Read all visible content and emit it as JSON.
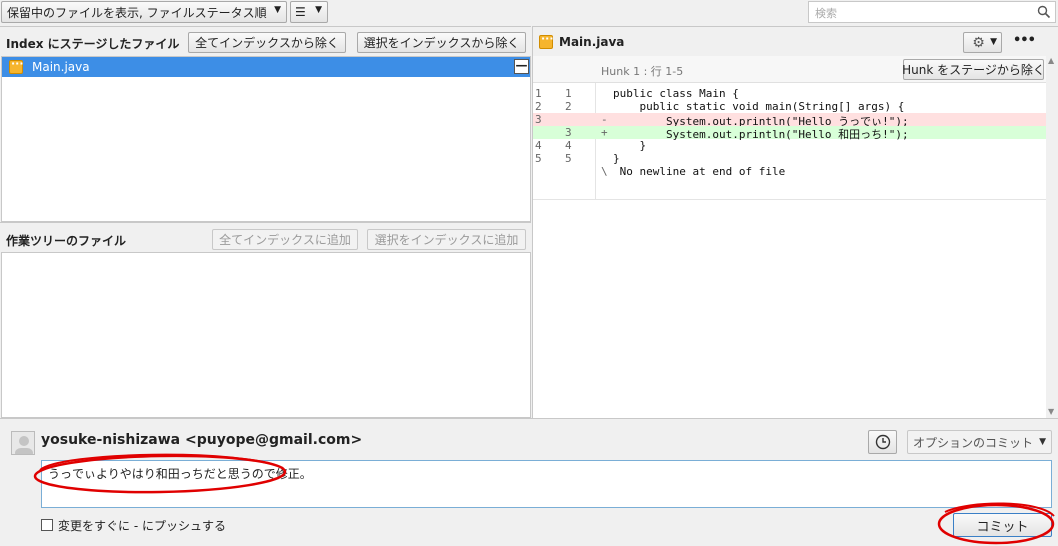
{
  "toolbar": {
    "view_mode": "保留中のファイルを表示, ファイルステータス順",
    "list_menu": "☰",
    "search_placeholder": "検索"
  },
  "staged": {
    "title": "Index にステージしたファイル",
    "remove_all": "全てインデックスから除く",
    "remove_selected": "選択をインデックスから除く",
    "files": [
      {
        "name": "Main.java",
        "toggle": "—"
      }
    ]
  },
  "working": {
    "title": "作業ツリーのファイル",
    "add_all": "全てインデックスに追加",
    "add_selected": "選択をインデックスに追加"
  },
  "diff": {
    "filename": "Main.java",
    "more": "•••",
    "hunk_label": "Hunk 1 : 行 1-5",
    "unstage_hunk": "Hunk をステージから除く",
    "lines": [
      {
        "old": "1",
        "new": "1",
        "sign": "",
        "type": "ctx",
        "text": "public class Main {"
      },
      {
        "old": "2",
        "new": "2",
        "sign": "",
        "type": "ctx",
        "text": "    public static void main(String[] args) {"
      },
      {
        "old": "3",
        "new": "",
        "sign": "-",
        "type": "del",
        "text": "        System.out.println(\"Hello うっでぃ!\");"
      },
      {
        "old": "",
        "new": "3",
        "sign": "+",
        "type": "add",
        "text": "        System.out.println(\"Hello 和田っち!\");"
      },
      {
        "old": "4",
        "new": "4",
        "sign": "",
        "type": "ctx",
        "text": "    }"
      },
      {
        "old": "5",
        "new": "5",
        "sign": "",
        "type": "ctx",
        "text": "}"
      },
      {
        "old": "",
        "new": "",
        "sign": "\\",
        "type": "ctx",
        "text": " No newline at end of file"
      }
    ]
  },
  "commit": {
    "author": "yosuke-nishizawa <puyope@gmail.com>",
    "options": "オプションのコミット",
    "message": "うっでぃよりやはり和田っちだと思うので修正。",
    "push_label": "変更をすぐに - にプッシュする",
    "commit_button": "コミット"
  },
  "colors": {
    "selection": "#3d8ee6",
    "del_bg": "#ffe0e0",
    "add_bg": "#d8ffd8",
    "annotation": "#e00000"
  }
}
